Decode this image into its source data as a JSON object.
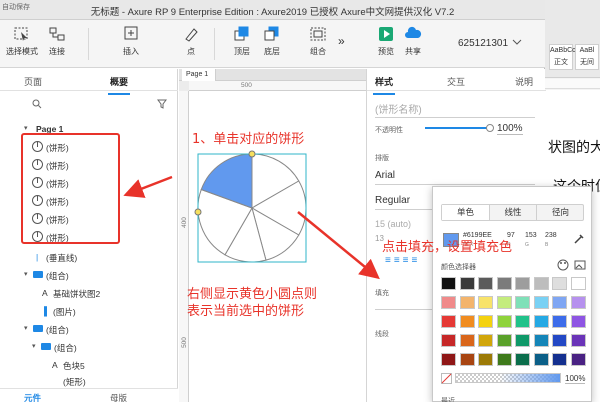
{
  "window": {
    "title": "无标题 - Axure RP 9 Enterprise Edition : Axure2019 已授权    Axure中文网提供汉化 V7.2",
    "corner_label": "自动保存"
  },
  "toolbar": {
    "select_mode": "选择模式",
    "connect": "连接",
    "insert": "插入",
    "point": "点",
    "top": "顶层",
    "bottom": "底层",
    "group": "组合",
    "preview": "预览",
    "share": "共享",
    "user_id": "625121301"
  },
  "left_panel": {
    "tabs": [
      "页面",
      "概要"
    ],
    "active_tab": "概要",
    "page_label": "Page 1",
    "pie_items": [
      "(饼形)",
      "(饼形)",
      "(饼形)",
      "(饼形)",
      "(饼形)",
      "(饼形)"
    ],
    "vertical_line": "(垂直线)",
    "group1": "(组合)",
    "basic_pie": "基础饼状图2",
    "image": "(图片)",
    "group2": "(组合)",
    "group3": "(组合)",
    "color_block": "色块5",
    "rect": "(矩形)",
    "bottom_tabs": [
      "元件",
      "母版"
    ]
  },
  "canvas": {
    "tab_label": "Page 1",
    "ruler_h": [
      "500"
    ],
    "ruler_v": [
      "400",
      "500"
    ]
  },
  "inspector": {
    "tabs": [
      "样式",
      "交互",
      "说明"
    ],
    "active_tab": "样式",
    "shape_name_placeholder": "(饼形名称)",
    "opacity_label": "不透明性",
    "opacity_value": "100%",
    "typography_label": "排版",
    "font_family": "Arial",
    "font_weight": "Regular",
    "font_size": "15 (auto)",
    "font_size_short": "13",
    "fill_label": "填充",
    "line_label": "线段"
  },
  "color_picker": {
    "tabs": [
      "单色",
      "线性",
      "径向"
    ],
    "active_tab": "单色",
    "hex": "#6199EE",
    "r": "97",
    "g": "153",
    "b": "238",
    "r_label": "R",
    "g_label": "G",
    "b_label": "B",
    "palette_label": "颜色选择器",
    "alpha_value": "100%",
    "recent_label": "最近",
    "selected_color": "#6199ee",
    "palette": [
      [
        "#111111",
        "#3a3a3a",
        "#5b5b5b",
        "#7b7b7b",
        "#9d9d9d",
        "#bdbdbd",
        "#dedede",
        "#ffffff"
      ],
      [
        "#f08a8a",
        "#f3b46c",
        "#f8e36a",
        "#c4ec7d",
        "#7fe0b8",
        "#79d1f4",
        "#7fa6f3",
        "#b691ee"
      ],
      [
        "#e53935",
        "#f08c20",
        "#f4d20f",
        "#8fd33b",
        "#21c28a",
        "#25a9e4",
        "#3d6cea",
        "#8e55e3"
      ],
      [
        "#c62828",
        "#d9661b",
        "#d1a60b",
        "#5aa12a",
        "#0f9969",
        "#1485b8",
        "#2348c5",
        "#6a34b8"
      ],
      [
        "#8f1717",
        "#a84512",
        "#9c7a06",
        "#3e7a1b",
        "#0b6e4c",
        "#0b5f88",
        "#14308f",
        "#4a2283"
      ]
    ]
  },
  "bg_doc": {
    "style1": "AaBbCcDdEe",
    "style1_sub": "正文",
    "style2": "AaBl",
    "style2_sub": "无间",
    "text1": "状图的大小",
    "text2": "这个时位"
  },
  "annotations": {
    "note1": "1、单击对应的饼形",
    "note2_line1": "右侧显示黄色小圆点则",
    "note2_line2": "表示当前选中的饼形",
    "note3": "点击填充，设置填充色"
  },
  "chart_data": {
    "type": "pie",
    "slice_count": 6,
    "selected_slice_color": "#6199ee",
    "default_slice_color": "#ffffff"
  }
}
